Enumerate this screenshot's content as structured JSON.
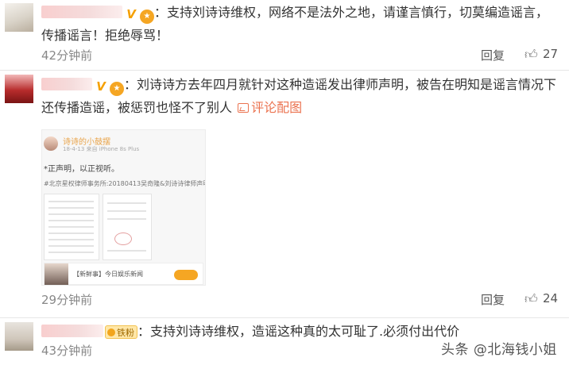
{
  "comments": [
    {
      "text": "：支持刘诗诗维权，网络不是法外之地，请谨言慎行，切莫编造谣言，传播谣言！拒绝辱骂！",
      "time": "42分钟前",
      "reply_label": "回复",
      "likes": "27"
    },
    {
      "text": "：刘诗诗方去年四月就针对这种造谣发出律师声明，被告在明知是谣言情况下还传播造谣，被惩罚也怪不了别人",
      "image_link_label": "评论配图",
      "time": "29分钟前",
      "reply_label": "回复",
      "likes": "24",
      "embedded_image": {
        "account_name": "诗诗的小鼓摆",
        "meta": "18-4-13  来自 iPhone 8s Plus",
        "line1": "*正声明，以正视听。",
        "line2": "#北京星权律师事务所:20180413吴奇隆&刘诗诗律师声明",
        "card_text": "【新鲜事】今日娱乐新闻"
      }
    },
    {
      "badge_label": "铁粉",
      "text": "：支持刘诗诗维权，造谣这种真的太可耻了.必须付出代价",
      "time": "43分钟前"
    }
  ],
  "watermark": "头条 @北海钱小姐",
  "colors": {
    "link": "#eb7350",
    "time_text": "#888888",
    "vip_badge": "#f5a000",
    "divider": "#e6e6e6"
  },
  "icons": [
    "vip-v-icon",
    "medal-icon",
    "image-icon",
    "thumbs-up-icon",
    "fan-badge-icon"
  ]
}
